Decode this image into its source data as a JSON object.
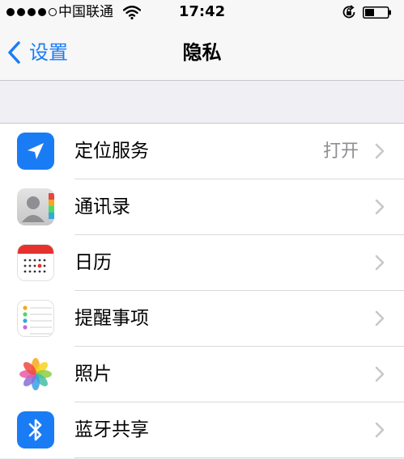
{
  "status_bar": {
    "carrier": "中国联通",
    "time": "17:42",
    "signal_strength": 4,
    "signal_max": 5
  },
  "nav": {
    "back_label": "设置",
    "title": "隐私"
  },
  "colors": {
    "accent": "#1a7cf5",
    "location_icon_bg": "#1a7cf5",
    "bluetooth_icon_bg": "#1a7cf5",
    "calendar_red": "#e5322d",
    "secondary_text": "#8e8e93"
  },
  "items": [
    {
      "label": "定位服务",
      "value": "打开",
      "icon": "location-arrow-icon"
    },
    {
      "label": "通讯录",
      "value": "",
      "icon": "contacts-icon"
    },
    {
      "label": "日历",
      "value": "",
      "icon": "calendar-icon"
    },
    {
      "label": "提醒事项",
      "value": "",
      "icon": "reminders-icon"
    },
    {
      "label": "照片",
      "value": "",
      "icon": "photos-icon"
    },
    {
      "label": "蓝牙共享",
      "value": "",
      "icon": "bluetooth-icon"
    }
  ]
}
